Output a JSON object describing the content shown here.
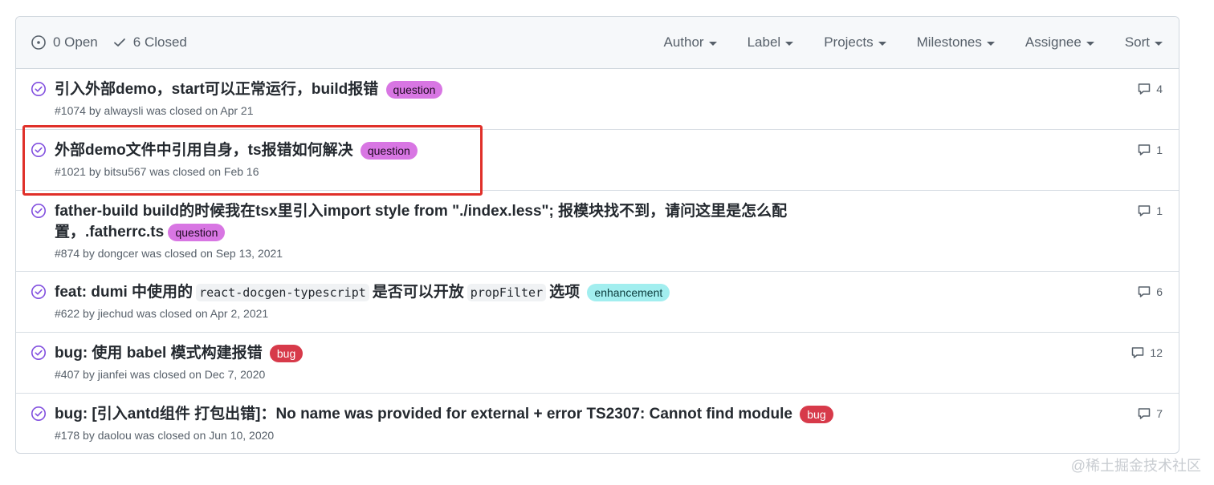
{
  "header": {
    "open_label": "0 Open",
    "closed_label": "6 Closed",
    "filters": [
      "Author",
      "Label",
      "Projects",
      "Milestones",
      "Assignee",
      "Sort"
    ]
  },
  "issues": [
    {
      "title": "引入外部demo，start可以正常运行，build报错",
      "label": "question",
      "meta": "#1074 by alwaysli was closed on Apr 21",
      "comments": "4"
    },
    {
      "title": "外部demo文件中引用自身，ts报错如何解决",
      "label": "question",
      "meta": "#1021 by bitsu567 was closed on Feb 16",
      "comments": "1"
    },
    {
      "title": "father-build build的时候我在tsx里引入import style from \"./index.less\"; 报模块找不到，请问这里是怎么配置，.fatherrc.ts",
      "label": "question",
      "meta": "#874 by dongcer was closed on Sep 13, 2021",
      "comments": "1"
    },
    {
      "title_parts": [
        "feat: dumi 中使用的",
        "react-docgen-typescript",
        "是否可以开放",
        "propFilter",
        "选项"
      ],
      "label": "enhancement",
      "meta": "#622 by jiechud was closed on Apr 2, 2021",
      "comments": "6"
    },
    {
      "title": "bug: 使用 babel 模式构建报错",
      "label": "bug",
      "meta": "#407 by jianfei was closed on Dec 7, 2020",
      "comments": "12"
    },
    {
      "title": "bug: [引入antd组件 打包出错]：No name was provided for external + error TS2307: Cannot find module",
      "label": "bug",
      "meta": "#178 by daolou was closed on Jun 10, 2020",
      "comments": "7"
    }
  ],
  "watermark": "@稀土掘金技术社区",
  "colors": {
    "closed_icon": "#8250df",
    "label_question": "#d876e3",
    "label_enhancement": "#a2eeef",
    "label_bug": "#d73a4a",
    "highlight": "#e0302a"
  }
}
